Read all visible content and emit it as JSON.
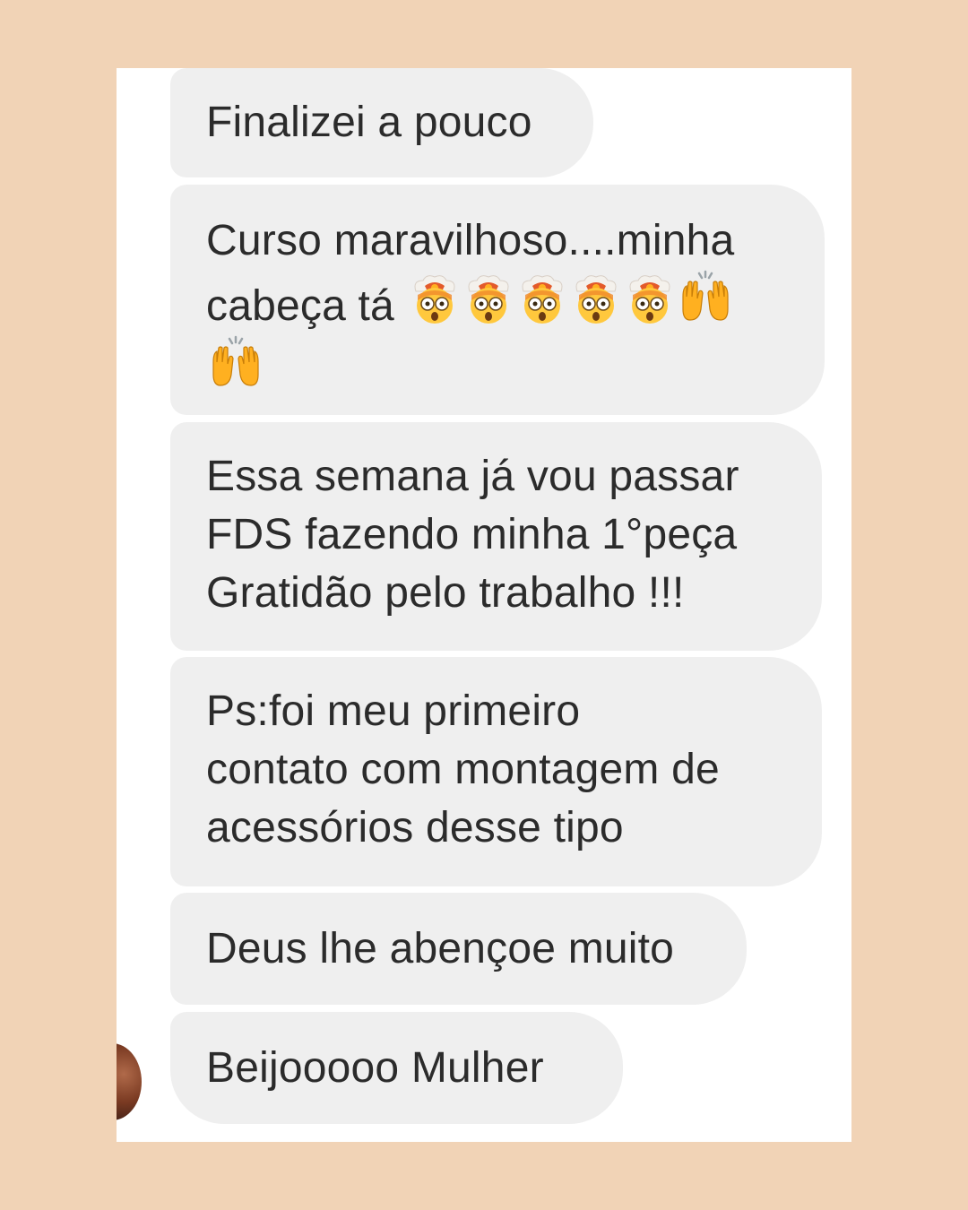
{
  "messages": [
    {
      "lines": [
        "Finalizei a pouco"
      ]
    },
    {
      "lines": [
        "Curso maravilhoso....minha",
        "cabeça tá"
      ]
    },
    {
      "lines": [
        "Essa semana já vou passar",
        "FDS fazendo minha 1°peça",
        "Gratidão pelo trabalho !!!"
      ]
    },
    {
      "lines": [
        "Ps:foi meu primeiro",
        "contato com montagem de",
        "acessórios desse tipo"
      ]
    },
    {
      "lines": [
        "Deus lhe abençoe muito"
      ]
    },
    {
      "lines": [
        "Beijooooo  Mulher"
      ]
    }
  ],
  "emoji_row": {
    "exploding_head_count": 5,
    "raised_hands_count": 2
  },
  "colors": {
    "page_background": "#f1d3b6",
    "bubble_background": "#efefef",
    "text": "#2b2b2b"
  }
}
